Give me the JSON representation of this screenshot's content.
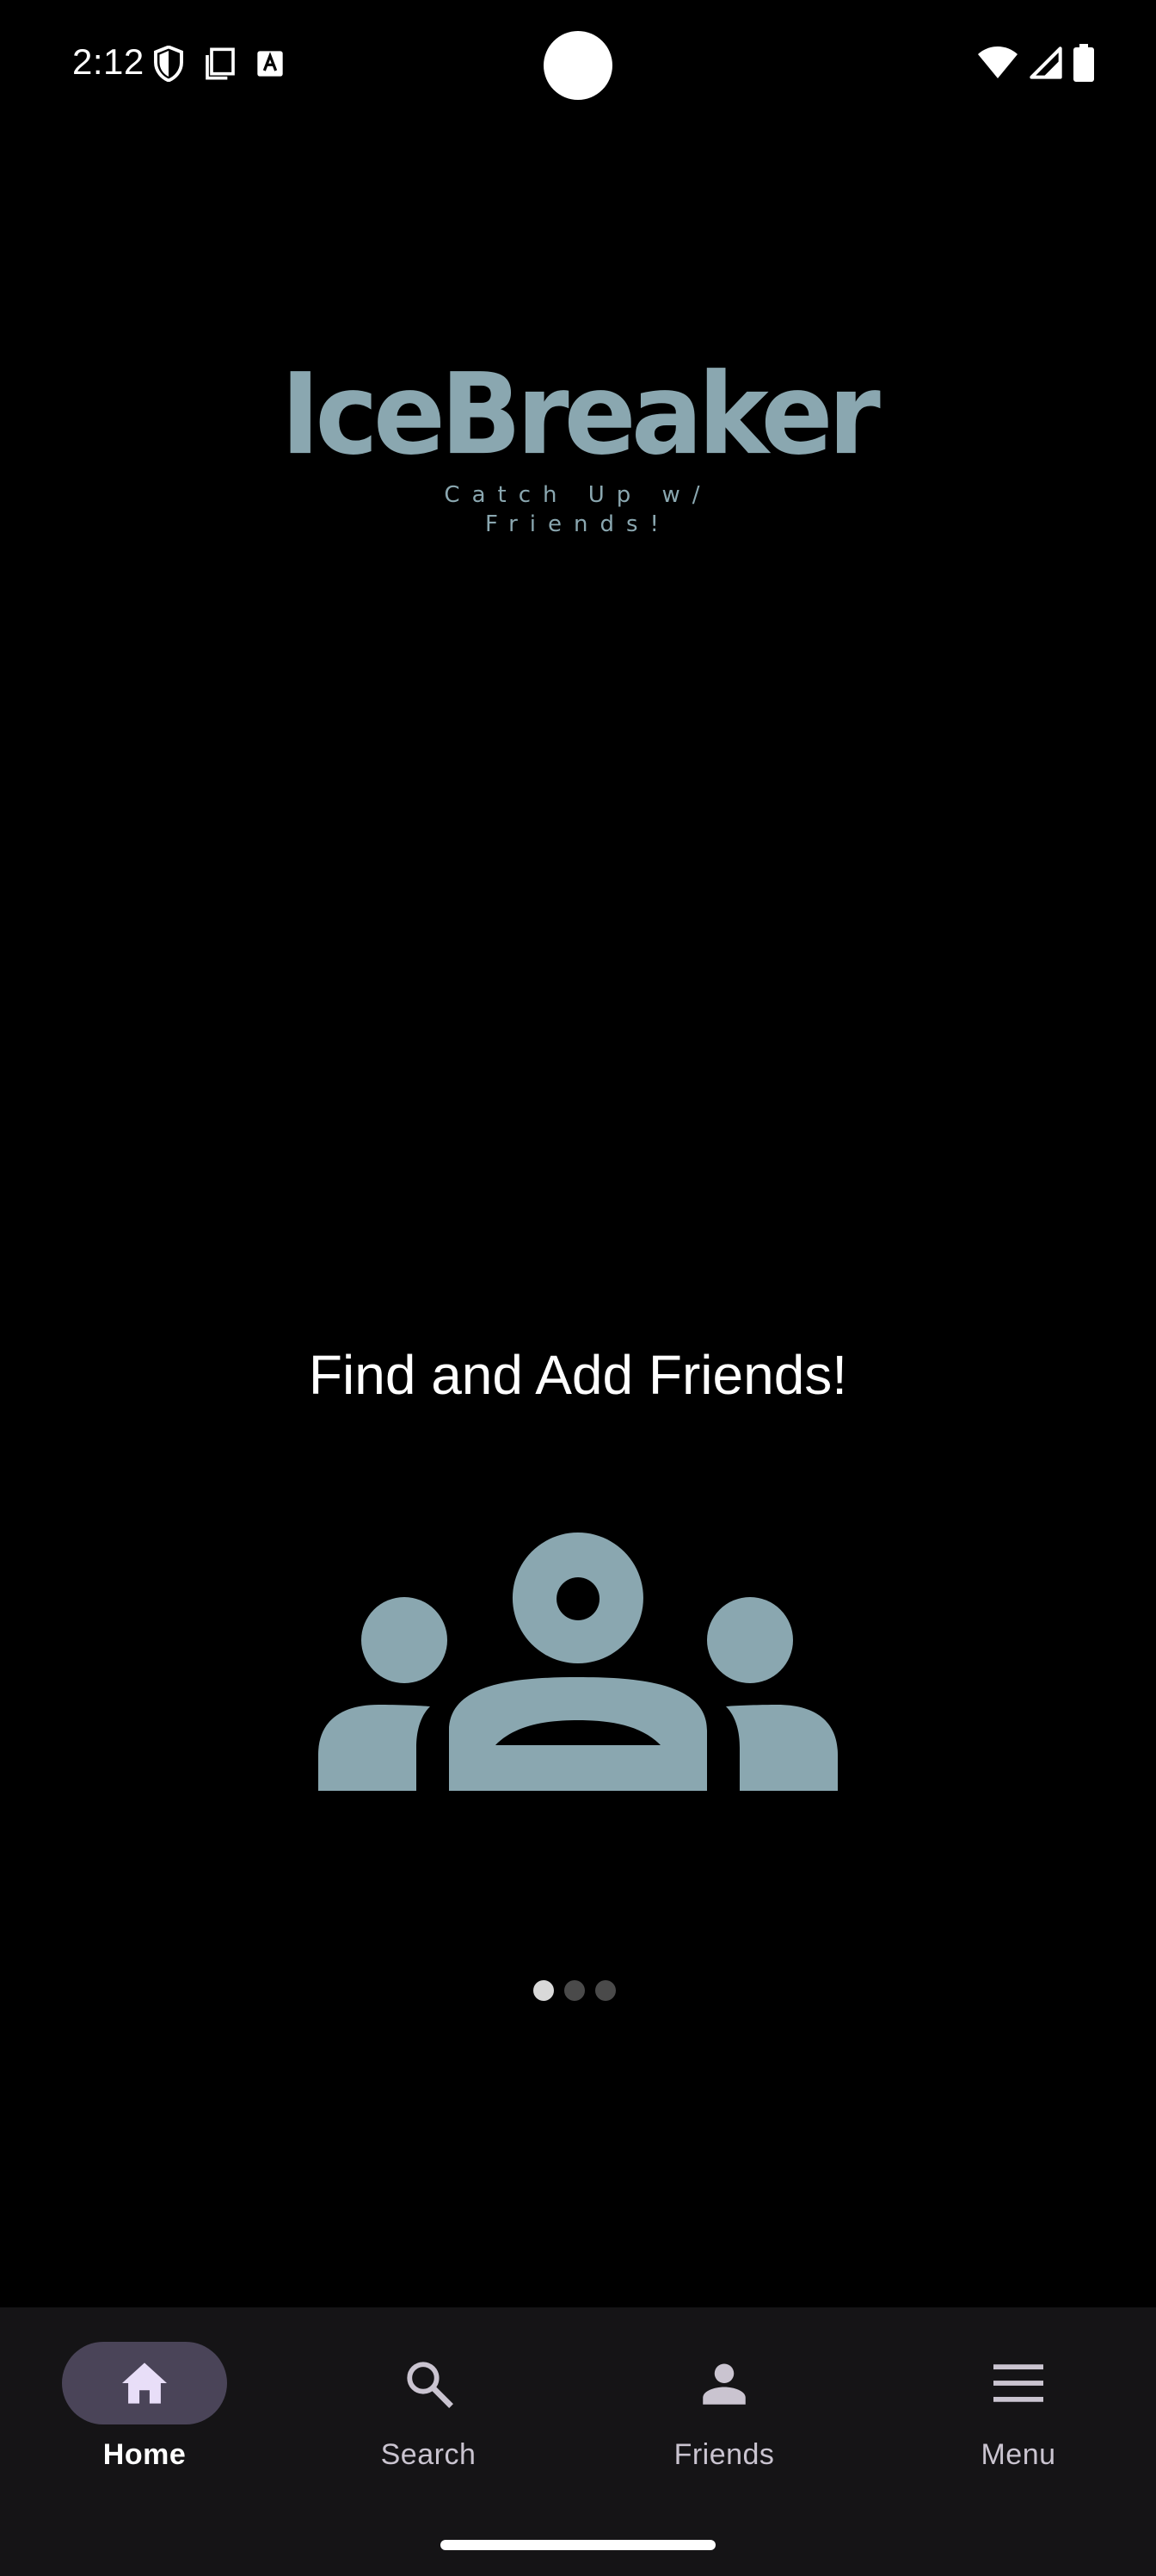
{
  "status_bar": {
    "time": "2:12",
    "icons_left": [
      "shield-icon",
      "copy-icon",
      "a-badge-icon"
    ],
    "icons_right": [
      "wifi-icon",
      "signal-icon",
      "battery-icon"
    ]
  },
  "logo": {
    "title": "IceBreaker",
    "tagline": "Catch Up w/ Friends!",
    "color": "#8aa7b0"
  },
  "onboarding": {
    "headline": "Find and Add Friends!",
    "illustration_icon": "group-icon",
    "illustration_color": "#8aa7b0",
    "page_count": 3,
    "current_page": 1
  },
  "bottom_nav": {
    "items": [
      {
        "label": "Home",
        "icon": "home-icon",
        "active": true
      },
      {
        "label": "Search",
        "icon": "search-icon",
        "active": false
      },
      {
        "label": "Friends",
        "icon": "person-icon",
        "active": false
      },
      {
        "label": "Menu",
        "icon": "menu-icon",
        "active": false
      }
    ],
    "background": "#151416",
    "active_indicator": "#4a4458"
  }
}
